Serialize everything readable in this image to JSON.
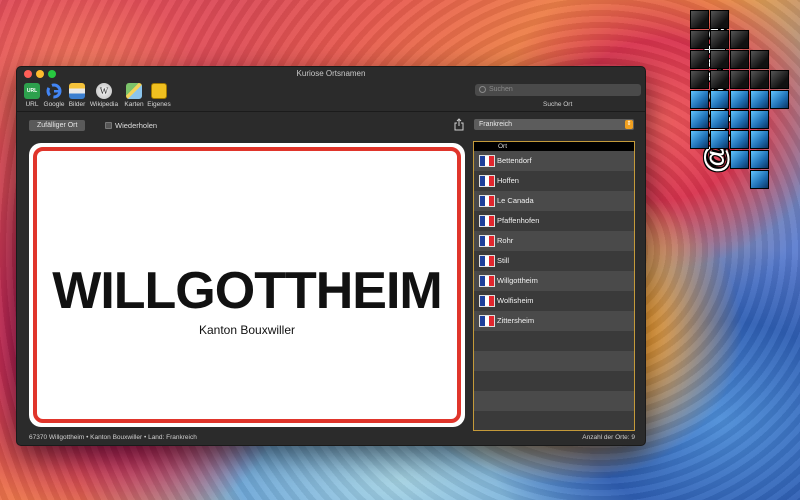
{
  "watermark": {
    "text": "@pps4Me"
  },
  "window": {
    "title": "Kuriose Ortsnamen"
  },
  "toolbar": {
    "items": [
      {
        "label": "URL",
        "icon": "url-icon",
        "color": "#2da14d"
      },
      {
        "label": "Google",
        "icon": "google-icon",
        "color": "#ffffff"
      },
      {
        "label": "Bilder",
        "icon": "images-icon",
        "color": "#f4c23a"
      },
      {
        "label": "Wikipedia",
        "icon": "wikipedia-icon",
        "color": "#e8e8e8"
      },
      {
        "label": "Karten",
        "icon": "map-icon",
        "color": "#7cc36a"
      },
      {
        "label": "Eigenes",
        "icon": "custom-icon",
        "color": "#f0c020"
      }
    ],
    "search_placeholder": "Suchen",
    "search_label": "Suche Ort"
  },
  "controls": {
    "random_button": "Zufälliger Ort",
    "repeat_label": "Wiederholen",
    "country": "Frankreich"
  },
  "sign": {
    "name": "WILLGOTTHEIM",
    "subtitle": "Kanton Bouxwiller",
    "border_color": "#e0352b"
  },
  "list": {
    "header": "Ort",
    "items": [
      "Bettendorf",
      "Hoffen",
      "Le Canada",
      "Pfaffenhofen",
      "Rohr",
      "Still",
      "Willgottheim",
      "Wolfisheim",
      "Zittersheim"
    ],
    "empty_rows": 5
  },
  "status": {
    "left": "67370 Willgottheim • Kanton Bouxwiller • Land: Frankreich",
    "right": "Anzahl der Orte: 9"
  }
}
